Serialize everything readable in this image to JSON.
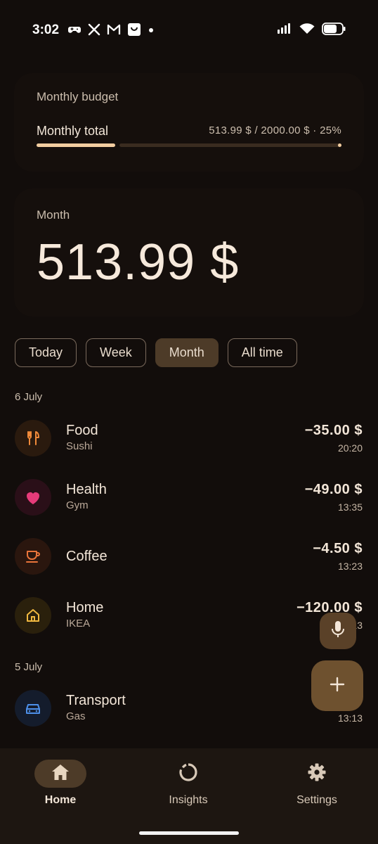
{
  "status_bar": {
    "time": "3:02",
    "left_icons": [
      "game-controller-icon",
      "x-logo-icon",
      "gmail-icon",
      "shopping-bag-icon",
      "dot-icon"
    ],
    "right_icons": [
      "signal-icon",
      "wifi-icon",
      "battery-icon"
    ]
  },
  "budget": {
    "title": "Monthly budget",
    "row_label": "Monthly total",
    "row_value": "513.99 $ / 2000.00 $ · 25%",
    "progress_fraction": 0.257,
    "accent_color": "#f2cda0"
  },
  "summary": {
    "label": "Month",
    "amount": "513.99 $"
  },
  "filters": {
    "items": [
      "Today",
      "Week",
      "Month",
      "All time"
    ],
    "selected": "Month"
  },
  "groups": [
    {
      "date": "6 July",
      "transactions": [
        {
          "category": "Food",
          "note": "Sushi",
          "amount": "−35.00 $",
          "time": "20:20",
          "icon": "fork-knife-icon",
          "color": "#f08a3a"
        },
        {
          "category": "Health",
          "note": "Gym",
          "amount": "−49.00 $",
          "time": "13:35",
          "icon": "heart-icon",
          "color": "#e63b7a"
        },
        {
          "category": "Coffee",
          "note": "",
          "amount": "−4.50 $",
          "time": "13:23",
          "icon": "coffee-cup-icon",
          "color": "#e8743a"
        },
        {
          "category": "Home",
          "note": "IKEA",
          "amount": "−120.00 $",
          "time": "13:13",
          "icon": "house-icon",
          "color": "#f0b840"
        }
      ]
    },
    {
      "date": "5 July",
      "transactions": [
        {
          "category": "Transport",
          "note": "Gas",
          "amount": "−",
          "time": "13:13",
          "icon": "car-icon",
          "color": "#4d8fe8"
        }
      ]
    }
  ],
  "fabs": {
    "mic_icon": "microphone-icon",
    "add_icon": "plus-icon"
  },
  "nav": {
    "items": [
      {
        "label": "Home",
        "icon": "home-icon",
        "active": true
      },
      {
        "label": "Insights",
        "icon": "donut-chart-icon",
        "active": false
      },
      {
        "label": "Settings",
        "icon": "gear-icon",
        "active": false
      }
    ]
  }
}
